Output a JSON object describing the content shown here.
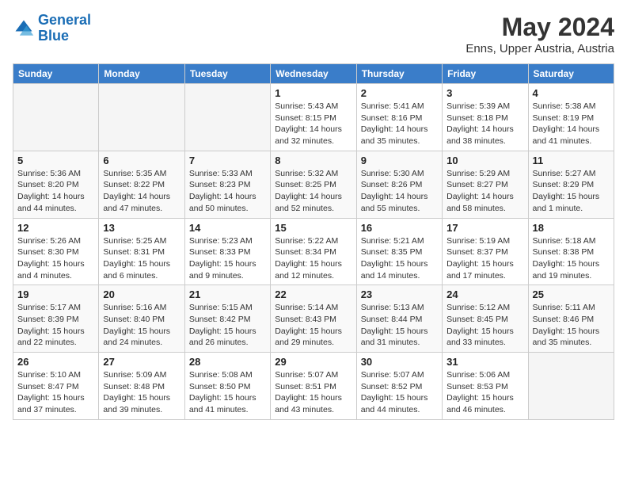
{
  "header": {
    "logo_line1": "General",
    "logo_line2": "Blue",
    "month_year": "May 2024",
    "location": "Enns, Upper Austria, Austria"
  },
  "weekdays": [
    "Sunday",
    "Monday",
    "Tuesday",
    "Wednesday",
    "Thursday",
    "Friday",
    "Saturday"
  ],
  "weeks": [
    [
      {
        "day": "",
        "info": ""
      },
      {
        "day": "",
        "info": ""
      },
      {
        "day": "",
        "info": ""
      },
      {
        "day": "1",
        "info": "Sunrise: 5:43 AM\nSunset: 8:15 PM\nDaylight: 14 hours\nand 32 minutes."
      },
      {
        "day": "2",
        "info": "Sunrise: 5:41 AM\nSunset: 8:16 PM\nDaylight: 14 hours\nand 35 minutes."
      },
      {
        "day": "3",
        "info": "Sunrise: 5:39 AM\nSunset: 8:18 PM\nDaylight: 14 hours\nand 38 minutes."
      },
      {
        "day": "4",
        "info": "Sunrise: 5:38 AM\nSunset: 8:19 PM\nDaylight: 14 hours\nand 41 minutes."
      }
    ],
    [
      {
        "day": "5",
        "info": "Sunrise: 5:36 AM\nSunset: 8:20 PM\nDaylight: 14 hours\nand 44 minutes."
      },
      {
        "day": "6",
        "info": "Sunrise: 5:35 AM\nSunset: 8:22 PM\nDaylight: 14 hours\nand 47 minutes."
      },
      {
        "day": "7",
        "info": "Sunrise: 5:33 AM\nSunset: 8:23 PM\nDaylight: 14 hours\nand 50 minutes."
      },
      {
        "day": "8",
        "info": "Sunrise: 5:32 AM\nSunset: 8:25 PM\nDaylight: 14 hours\nand 52 minutes."
      },
      {
        "day": "9",
        "info": "Sunrise: 5:30 AM\nSunset: 8:26 PM\nDaylight: 14 hours\nand 55 minutes."
      },
      {
        "day": "10",
        "info": "Sunrise: 5:29 AM\nSunset: 8:27 PM\nDaylight: 14 hours\nand 58 minutes."
      },
      {
        "day": "11",
        "info": "Sunrise: 5:27 AM\nSunset: 8:29 PM\nDaylight: 15 hours\nand 1 minute."
      }
    ],
    [
      {
        "day": "12",
        "info": "Sunrise: 5:26 AM\nSunset: 8:30 PM\nDaylight: 15 hours\nand 4 minutes."
      },
      {
        "day": "13",
        "info": "Sunrise: 5:25 AM\nSunset: 8:31 PM\nDaylight: 15 hours\nand 6 minutes."
      },
      {
        "day": "14",
        "info": "Sunrise: 5:23 AM\nSunset: 8:33 PM\nDaylight: 15 hours\nand 9 minutes."
      },
      {
        "day": "15",
        "info": "Sunrise: 5:22 AM\nSunset: 8:34 PM\nDaylight: 15 hours\nand 12 minutes."
      },
      {
        "day": "16",
        "info": "Sunrise: 5:21 AM\nSunset: 8:35 PM\nDaylight: 15 hours\nand 14 minutes."
      },
      {
        "day": "17",
        "info": "Sunrise: 5:19 AM\nSunset: 8:37 PM\nDaylight: 15 hours\nand 17 minutes."
      },
      {
        "day": "18",
        "info": "Sunrise: 5:18 AM\nSunset: 8:38 PM\nDaylight: 15 hours\nand 19 minutes."
      }
    ],
    [
      {
        "day": "19",
        "info": "Sunrise: 5:17 AM\nSunset: 8:39 PM\nDaylight: 15 hours\nand 22 minutes."
      },
      {
        "day": "20",
        "info": "Sunrise: 5:16 AM\nSunset: 8:40 PM\nDaylight: 15 hours\nand 24 minutes."
      },
      {
        "day": "21",
        "info": "Sunrise: 5:15 AM\nSunset: 8:42 PM\nDaylight: 15 hours\nand 26 minutes."
      },
      {
        "day": "22",
        "info": "Sunrise: 5:14 AM\nSunset: 8:43 PM\nDaylight: 15 hours\nand 29 minutes."
      },
      {
        "day": "23",
        "info": "Sunrise: 5:13 AM\nSunset: 8:44 PM\nDaylight: 15 hours\nand 31 minutes."
      },
      {
        "day": "24",
        "info": "Sunrise: 5:12 AM\nSunset: 8:45 PM\nDaylight: 15 hours\nand 33 minutes."
      },
      {
        "day": "25",
        "info": "Sunrise: 5:11 AM\nSunset: 8:46 PM\nDaylight: 15 hours\nand 35 minutes."
      }
    ],
    [
      {
        "day": "26",
        "info": "Sunrise: 5:10 AM\nSunset: 8:47 PM\nDaylight: 15 hours\nand 37 minutes."
      },
      {
        "day": "27",
        "info": "Sunrise: 5:09 AM\nSunset: 8:48 PM\nDaylight: 15 hours\nand 39 minutes."
      },
      {
        "day": "28",
        "info": "Sunrise: 5:08 AM\nSunset: 8:50 PM\nDaylight: 15 hours\nand 41 minutes."
      },
      {
        "day": "29",
        "info": "Sunrise: 5:07 AM\nSunset: 8:51 PM\nDaylight: 15 hours\nand 43 minutes."
      },
      {
        "day": "30",
        "info": "Sunrise: 5:07 AM\nSunset: 8:52 PM\nDaylight: 15 hours\nand 44 minutes."
      },
      {
        "day": "31",
        "info": "Sunrise: 5:06 AM\nSunset: 8:53 PM\nDaylight: 15 hours\nand 46 minutes."
      },
      {
        "day": "",
        "info": ""
      }
    ]
  ]
}
